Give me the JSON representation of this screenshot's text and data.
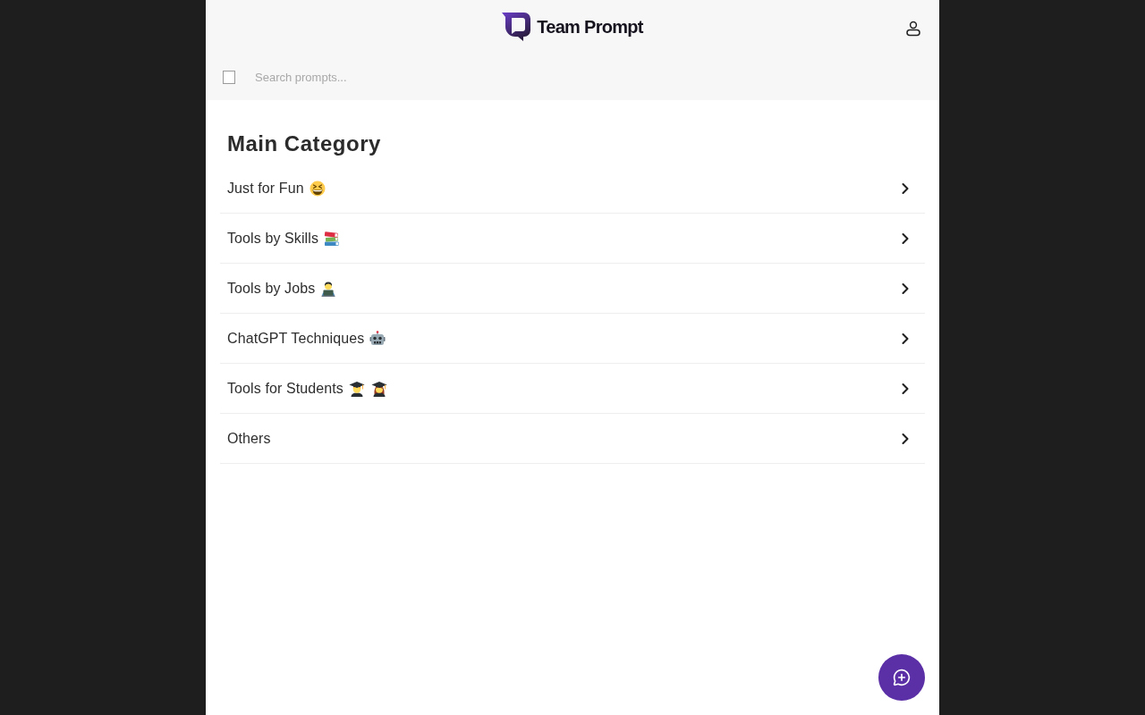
{
  "header": {
    "logo_text": "Team Prompt"
  },
  "search": {
    "placeholder": "Search prompts..."
  },
  "section_title": "Main Category",
  "categories": [
    {
      "label": "Just for Fun",
      "emojis": [
        {
          "kind": "laughing"
        }
      ]
    },
    {
      "label": "Tools by Skills",
      "emojis": [
        {
          "kind": "books"
        }
      ]
    },
    {
      "label": "Tools by Jobs",
      "emojis": [
        {
          "kind": "technologist"
        }
      ]
    },
    {
      "label": "ChatGPT Techniques",
      "emojis": [
        {
          "kind": "robot"
        }
      ]
    },
    {
      "label": "Tools for Students",
      "emojis": [
        {
          "kind": "man-student"
        },
        {
          "kind": "woman-student"
        }
      ]
    },
    {
      "label": "Others"
    }
  ]
}
